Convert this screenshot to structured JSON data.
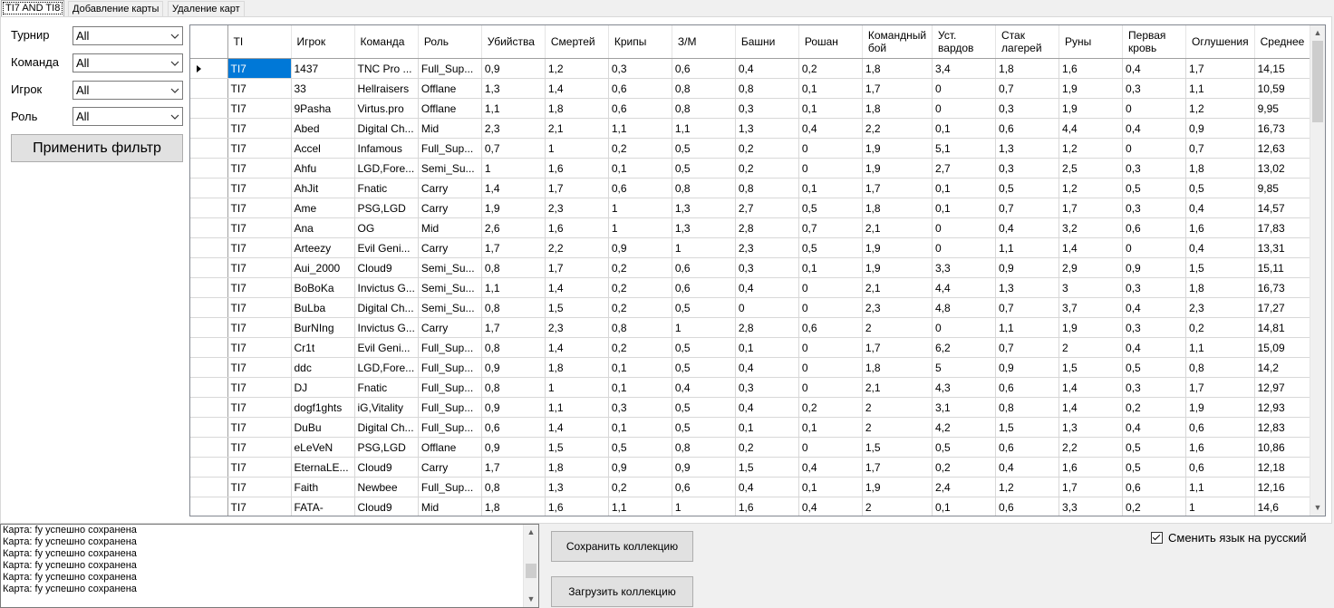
{
  "tabs": [
    {
      "label": "TI7 AND TI8",
      "active": true
    },
    {
      "label": "Добавление карты",
      "active": false
    },
    {
      "label": "Удаление карт",
      "active": false
    }
  ],
  "filters": {
    "tournament": {
      "label": "Турнир",
      "value": "All"
    },
    "team": {
      "label": "Команда",
      "value": "All"
    },
    "player": {
      "label": "Игрок",
      "value": "All"
    },
    "role": {
      "label": "Роль",
      "value": "All"
    },
    "apply_label": "Применить фильтр"
  },
  "grid": {
    "columns": [
      "TI",
      "Игрок",
      "Команда",
      "Роль",
      "Убийства",
      "Смертей",
      "Крипы",
      "З/М",
      "Башни",
      "Рошан",
      "Командный бой",
      "Уст. вардов",
      "Стак лагерей",
      "Руны",
      "Первая кровь",
      "Оглушения",
      "Среднее"
    ],
    "rows": [
      [
        "TI7",
        "1437",
        "TNC Pro ...",
        "Full_Sup...",
        "0,9",
        "1,2",
        "0,3",
        "0,6",
        "0,4",
        "0,2",
        "1,8",
        "3,4",
        "1,8",
        "1,6",
        "0,4",
        "1,7",
        "14,15"
      ],
      [
        "TI7",
        "33",
        "Hellraisers",
        "Offlane",
        "1,3",
        "1,4",
        "0,6",
        "0,8",
        "0,8",
        "0,1",
        "1,7",
        "0",
        "0,7",
        "1,9",
        "0,3",
        "1,1",
        "10,59"
      ],
      [
        "TI7",
        "9Pasha",
        "Virtus.pro",
        "Offlane",
        "1,1",
        "1,8",
        "0,6",
        "0,8",
        "0,3",
        "0,1",
        "1,8",
        "0",
        "0,3",
        "1,9",
        "0",
        "1,2",
        "9,95"
      ],
      [
        "TI7",
        "Abed",
        "Digital Ch...",
        "Mid",
        "2,3",
        "2,1",
        "1,1",
        "1,1",
        "1,3",
        "0,4",
        "2,2",
        "0,1",
        "0,6",
        "4,4",
        "0,4",
        "0,9",
        "16,73"
      ],
      [
        "TI7",
        "Accel",
        "Infamous",
        "Full_Sup...",
        "0,7",
        "1",
        "0,2",
        "0,5",
        "0,2",
        "0",
        "1,9",
        "5,1",
        "1,3",
        "1,2",
        "0",
        "0,7",
        "12,63"
      ],
      [
        "TI7",
        "Ahfu",
        "LGD,Fore...",
        "Semi_Su...",
        "1",
        "1,6",
        "0,1",
        "0,5",
        "0,2",
        "0",
        "1,9",
        "2,7",
        "0,3",
        "2,5",
        "0,3",
        "1,8",
        "13,02"
      ],
      [
        "TI7",
        "AhJit",
        "Fnatic",
        "Carry",
        "1,4",
        "1,7",
        "0,6",
        "0,8",
        "0,8",
        "0,1",
        "1,7",
        "0,1",
        "0,5",
        "1,2",
        "0,5",
        "0,5",
        "9,85"
      ],
      [
        "TI7",
        "Ame",
        "PSG,LGD",
        "Carry",
        "1,9",
        "2,3",
        "1",
        "1,3",
        "2,7",
        "0,5",
        "1,8",
        "0,1",
        "0,7",
        "1,7",
        "0,3",
        "0,4",
        "14,57"
      ],
      [
        "TI7",
        "Ana",
        "OG",
        "Mid",
        "2,6",
        "1,6",
        "1",
        "1,3",
        "2,8",
        "0,7",
        "2,1",
        "0",
        "0,4",
        "3,2",
        "0,6",
        "1,6",
        "17,83"
      ],
      [
        "TI7",
        "Arteezy",
        "Evil Geni...",
        "Carry",
        "1,7",
        "2,2",
        "0,9",
        "1",
        "2,3",
        "0,5",
        "1,9",
        "0",
        "1,1",
        "1,4",
        "0",
        "0,4",
        "13,31"
      ],
      [
        "TI7",
        "Aui_2000",
        "Cloud9",
        "Semi_Su...",
        "0,8",
        "1,7",
        "0,2",
        "0,6",
        "0,3",
        "0,1",
        "1,9",
        "3,3",
        "0,9",
        "2,9",
        "0,9",
        "1,5",
        "15,11"
      ],
      [
        "TI7",
        "BoBoKa",
        "Invictus G...",
        "Semi_Su...",
        "1,1",
        "1,4",
        "0,2",
        "0,6",
        "0,4",
        "0",
        "2,1",
        "4,4",
        "1,3",
        "3",
        "0,3",
        "1,8",
        "16,73"
      ],
      [
        "TI7",
        "BuLba",
        "Digital Ch...",
        "Semi_Su...",
        "0,8",
        "1,5",
        "0,2",
        "0,5",
        "0",
        "0",
        "2,3",
        "4,8",
        "0,7",
        "3,7",
        "0,4",
        "2,3",
        "17,27"
      ],
      [
        "TI7",
        "BurNIng",
        "Invictus G...",
        "Carry",
        "1,7",
        "2,3",
        "0,8",
        "1",
        "2,8",
        "0,6",
        "2",
        "0",
        "1,1",
        "1,9",
        "0,3",
        "0,2",
        "14,81"
      ],
      [
        "TI7",
        "Cr1t",
        "Evil Geni...",
        "Full_Sup...",
        "0,8",
        "1,4",
        "0,2",
        "0,5",
        "0,1",
        "0",
        "1,7",
        "6,2",
        "0,7",
        "2",
        "0,4",
        "1,1",
        "15,09"
      ],
      [
        "TI7",
        "ddc",
        "LGD,Fore...",
        "Full_Sup...",
        "0,9",
        "1,8",
        "0,1",
        "0,5",
        "0,4",
        "0",
        "1,8",
        "5",
        "0,9",
        "1,5",
        "0,5",
        "0,8",
        "14,2"
      ],
      [
        "TI7",
        "DJ",
        "Fnatic",
        "Full_Sup...",
        "0,8",
        "1",
        "0,1",
        "0,4",
        "0,3",
        "0",
        "2,1",
        "4,3",
        "0,6",
        "1,4",
        "0,3",
        "1,7",
        "12,97"
      ],
      [
        "TI7",
        "dogf1ghts",
        "iG,Vitality",
        "Full_Sup...",
        "0,9",
        "1,1",
        "0,3",
        "0,5",
        "0,4",
        "0,2",
        "2",
        "3,1",
        "0,8",
        "1,4",
        "0,2",
        "1,9",
        "12,93"
      ],
      [
        "TI7",
        "DuBu",
        "Digital Ch...",
        "Full_Sup...",
        "0,6",
        "1,4",
        "0,1",
        "0,5",
        "0,1",
        "0,1",
        "2",
        "4,2",
        "1,5",
        "1,3",
        "0,4",
        "0,6",
        "12,83"
      ],
      [
        "TI7",
        "eLeVeN",
        "PSG,LGD",
        "Offlane",
        "0,9",
        "1,5",
        "0,5",
        "0,8",
        "0,2",
        "0",
        "1,5",
        "0,5",
        "0,6",
        "2,2",
        "0,5",
        "1,6",
        "10,86"
      ],
      [
        "TI7",
        "EternaLE...",
        "Cloud9",
        "Carry",
        "1,7",
        "1,8",
        "0,9",
        "0,9",
        "1,5",
        "0,4",
        "1,7",
        "0,2",
        "0,4",
        "1,6",
        "0,5",
        "0,6",
        "12,18"
      ],
      [
        "TI7",
        "Faith",
        "Newbee",
        "Full_Sup...",
        "0,8",
        "1,3",
        "0,2",
        "0,6",
        "0,4",
        "0,1",
        "1,9",
        "2,4",
        "1,2",
        "1,7",
        "0,6",
        "1,1",
        "12,16"
      ],
      [
        "TI7",
        "FATA-",
        "Cloud9",
        "Mid",
        "1,8",
        "1,6",
        "1,1",
        "1",
        "1,6",
        "0,4",
        "2",
        "0,1",
        "0,6",
        "3,3",
        "0,2",
        "1",
        "14,6"
      ]
    ]
  },
  "log": {
    "lines": [
      "Карта: fy успешно сохранена",
      "Карта: fy успешно сохранена",
      "Карта: fy успешно сохранена",
      "Карта: fy успешно сохранена",
      "Карта: fy успешно сохранена",
      "Карта: fy успешно сохранена"
    ]
  },
  "buttons": {
    "save_label": "Сохранить коллекцию",
    "load_label": "Загрузить коллекцию"
  },
  "language_checkbox": {
    "label": "Сменить язык на русский",
    "checked": true
  },
  "colors": {
    "selection": "#0078d7",
    "window_bg": "#f0f0f0"
  }
}
